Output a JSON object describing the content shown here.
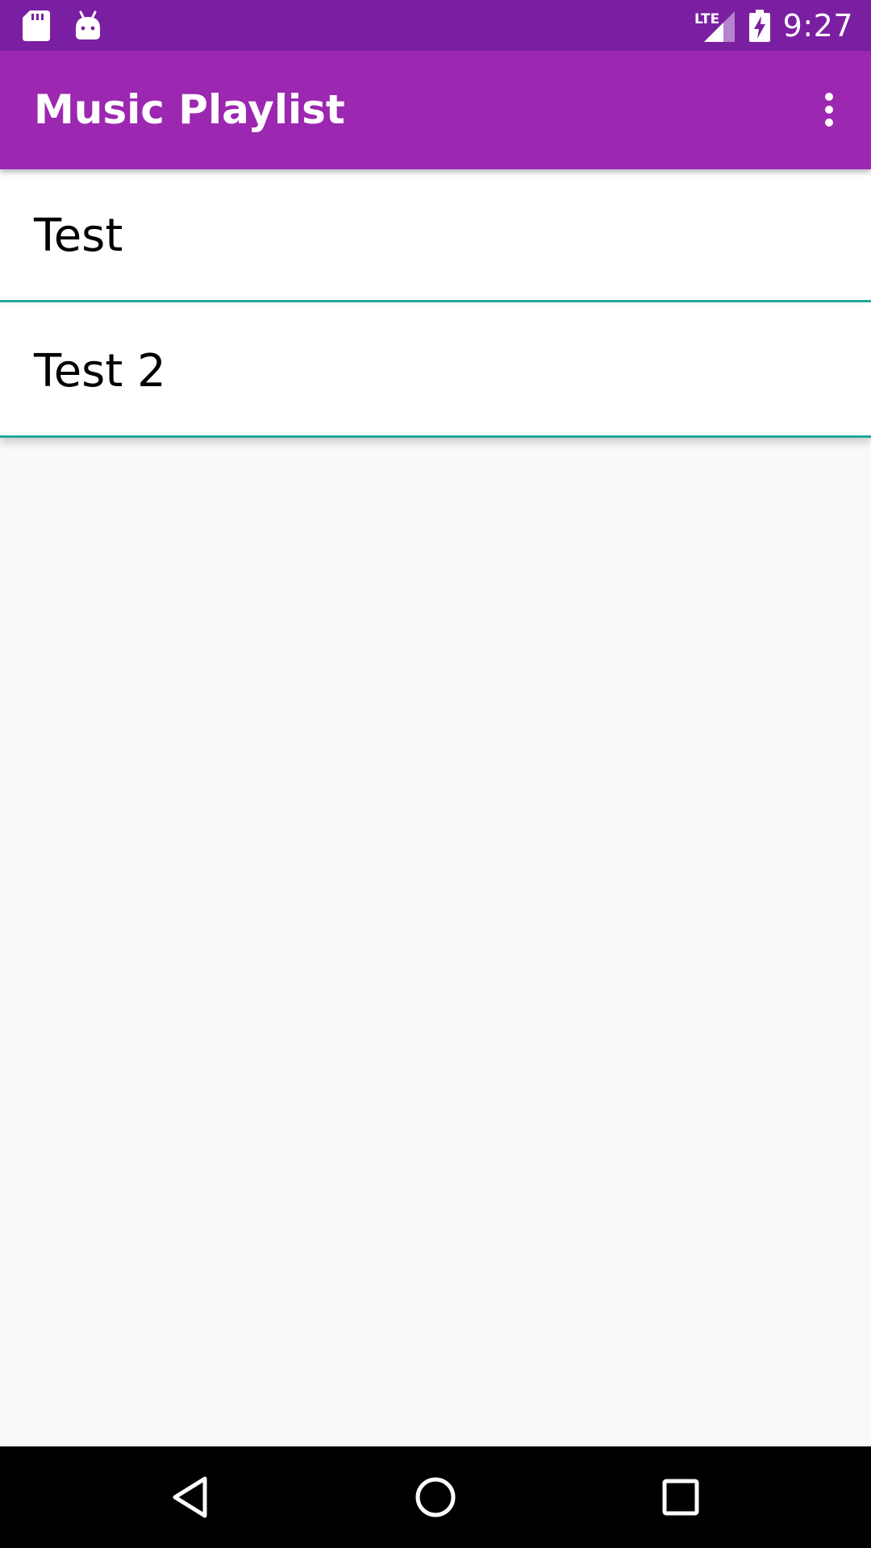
{
  "status_bar": {
    "time": "9:27",
    "network_label": "LTE",
    "background": "#7b1fa2",
    "left_icons": [
      "sd-card-icon",
      "android-debug-icon"
    ],
    "right_icons": [
      "lte-signal-icon",
      "battery-charging-icon"
    ]
  },
  "app_bar": {
    "title": "Music Playlist",
    "background": "#9c27b0",
    "menu_icon": "more-vert-icon"
  },
  "playlist": {
    "items": [
      {
        "label": "Test"
      },
      {
        "label": "Test 2"
      }
    ],
    "divider_color": "#26a69a"
  },
  "nav_bar": {
    "buttons": [
      "back-icon",
      "home-icon",
      "recents-icon"
    ]
  }
}
